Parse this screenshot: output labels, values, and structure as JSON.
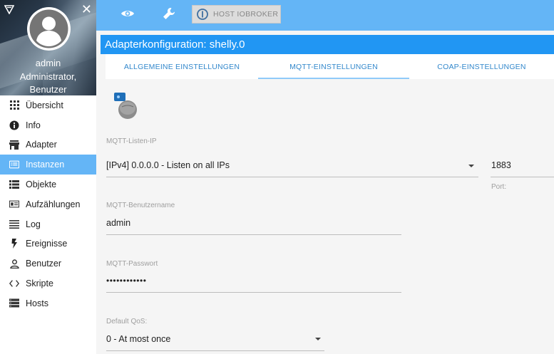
{
  "profile": {
    "name": "admin",
    "role_line1": "Administrator,",
    "role_line2": "Benutzer"
  },
  "sidebar": {
    "items": [
      {
        "label": "Übersicht",
        "icon": "grid-icon"
      },
      {
        "label": "Info",
        "icon": "info-icon"
      },
      {
        "label": "Adapter",
        "icon": "store-icon"
      },
      {
        "label": "Instanzen",
        "icon": "instances-icon",
        "active": true
      },
      {
        "label": "Objekte",
        "icon": "list-icon"
      },
      {
        "label": "Aufzählungen",
        "icon": "enums-icon"
      },
      {
        "label": "Log",
        "icon": "log-icon"
      },
      {
        "label": "Ereignisse",
        "icon": "bolt-icon"
      },
      {
        "label": "Benutzer",
        "icon": "user-icon"
      },
      {
        "label": "Skripte",
        "icon": "code-icon"
      },
      {
        "label": "Hosts",
        "icon": "hosts-icon"
      }
    ]
  },
  "topbar": {
    "host_label": "HOST IOBROKER"
  },
  "header": {
    "title": "Adapterkonfiguration: shelly.0"
  },
  "tabs": [
    {
      "label": "ALLGEMEINE EINSTELLUNGEN"
    },
    {
      "label": "MQTT-EINSTELLUNGEN",
      "active": true
    },
    {
      "label": "COAP-EINSTELLUNGEN"
    }
  ],
  "form": {
    "listen_ip": {
      "label": "MQTT-Listen-IP",
      "value": "[IPv4] 0.0.0.0 - Listen on all IPs"
    },
    "port": {
      "label": "Port:",
      "value": "1883"
    },
    "username": {
      "label": "MQTT-Benutzername",
      "value": "admin"
    },
    "password": {
      "label": "MQTT-Passwort",
      "value": "••••••••••••"
    },
    "qos": {
      "label": "Default QoS:",
      "value": "0 - At most once"
    }
  },
  "colors": {
    "topbar": "#64b5f6",
    "header": "#2196f3",
    "active_nav": "#64b5f6",
    "tab_text": "#3388cc"
  }
}
